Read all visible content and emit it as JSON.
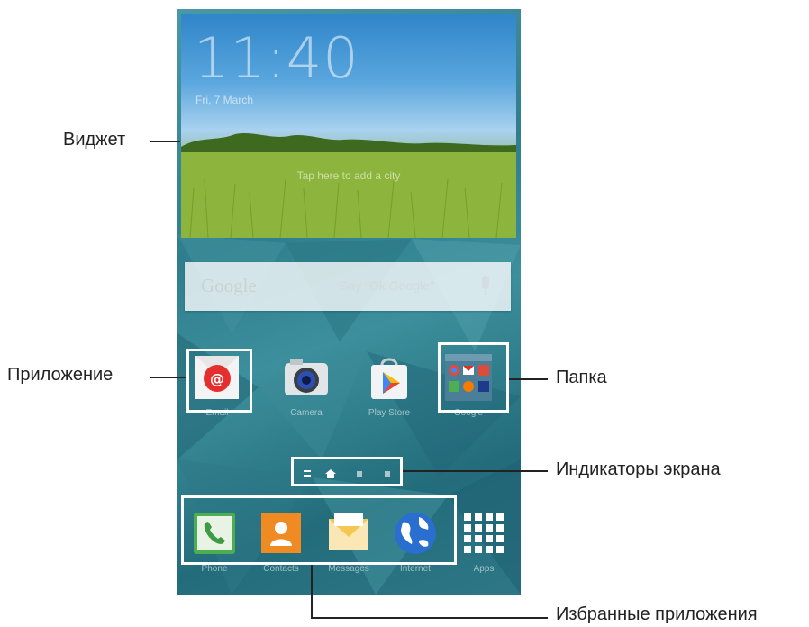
{
  "widget": {
    "time": "11:40",
    "date": "Fri, 7 March",
    "hint": "Tap here to add a city"
  },
  "search": {
    "logo": "Google",
    "hint": "Say \"Ok Google\"",
    "icon": "microphone-icon"
  },
  "apps": [
    {
      "label": "Email",
      "icon": "email-icon"
    },
    {
      "label": "Camera",
      "icon": "camera-icon"
    },
    {
      "label": "Play Store",
      "icon": "play-store-icon"
    },
    {
      "label": "Google",
      "icon": "google-folder-icon"
    }
  ],
  "page_indicator": {
    "pages": 4,
    "current": 2
  },
  "dock": [
    {
      "label": "Phone",
      "icon": "phone-icon"
    },
    {
      "label": "Contacts",
      "icon": "contacts-icon"
    },
    {
      "label": "Messages",
      "icon": "messages-icon"
    },
    {
      "label": "Internet",
      "icon": "internet-icon"
    },
    {
      "label": "Apps",
      "icon": "apps-grid-icon"
    }
  ],
  "callouts": {
    "widget": "Виджет",
    "app": "Приложение",
    "folder": "Папка",
    "indicators": "Индикаторы экрана",
    "favorites": "Избранные приложения"
  },
  "colors": {
    "highlight": "#ffffff",
    "callout_text": "#222222",
    "wallpaper": "#2f7d8d"
  }
}
